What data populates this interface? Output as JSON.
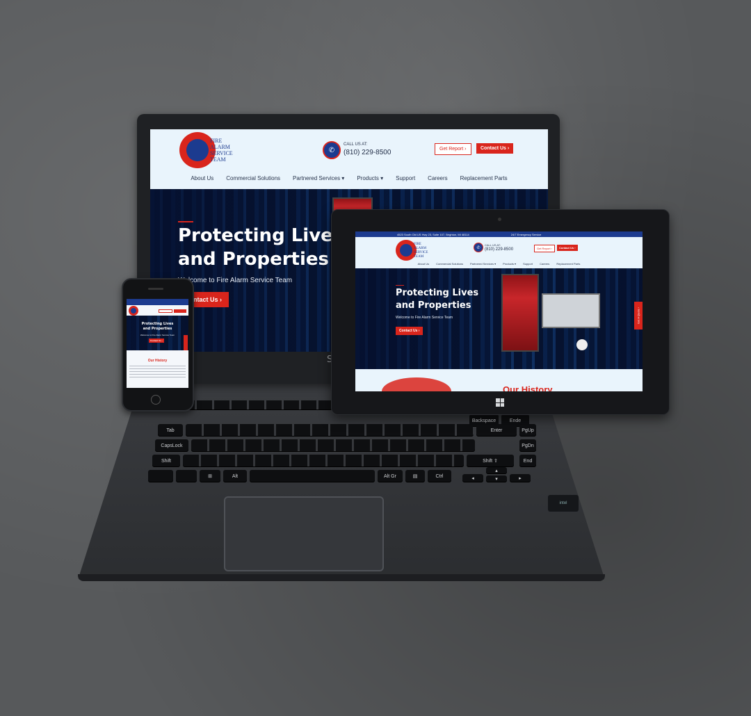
{
  "brand": {
    "logo_lines": [
      "FIRE",
      "ALARM",
      "SERVICE",
      "TEAM"
    ],
    "laptop_brand": "S"
  },
  "header": {
    "call_label": "CALL US AT:",
    "phone": "(810) 229-8500",
    "get_report": "Get Report ›",
    "contact_us": "Contact Us ›"
  },
  "nav": {
    "items": [
      "About Us",
      "Commercial Solutions",
      "Partnered Services ▾",
      "Products ▾",
      "Support",
      "Careers",
      "Replacement Parts"
    ]
  },
  "hero": {
    "title_line1": "Protecting Lives",
    "title_line2": "and Properties",
    "subtitle": "Welcome to Fire Alarm Service Team",
    "cta": "Contact Us ›"
  },
  "tablet": {
    "topbar_address": "4523 South Old US Hwy 23, Suite 107, Brighton, MI 48114",
    "topbar_emergency": "24/7 Emergency Service",
    "history_heading": "Our History",
    "side_tab": "Get A Quote ›"
  },
  "phone_site": {
    "history_heading": "Our History"
  },
  "keyboard": {
    "keys": [
      "Tab",
      "CapsLock",
      "Shift",
      "Alt",
      "Alt Gr",
      "Ctrl",
      "Enter",
      "Shift ⇧",
      "End",
      "PgUp",
      "PgDn",
      "Backspace",
      "Ende"
    ]
  },
  "colors": {
    "brand_red": "#d9251c",
    "brand_blue": "#1c3b8f",
    "background": "#57595b"
  }
}
